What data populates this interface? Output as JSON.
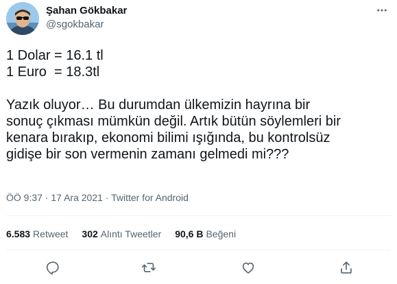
{
  "author": {
    "display_name": "Şahan Gökbakar",
    "handle": "@sgokbakar"
  },
  "tweet": {
    "lines": [
      "1 Dolar = 16.1 tl",
      "1 Euro  = 18.3tl",
      "",
      "Yazık oluyor… Bu durumdan ülkemizin hayrına bir",
      "sonuç çıkması mümkün değil. Artık bütün söylemleri bir",
      "kenara bırakıp, ekonomi bilimi ışığında, bu kontrolsüz",
      "gidişe bir son vermenin zamanı gelmedi mi???"
    ]
  },
  "meta": {
    "time": "ÖÖ 9:37",
    "separator": "·",
    "date": "17 Ara 2021",
    "source": "Twitter for Android"
  },
  "stats": {
    "retweets": {
      "count": "6.583",
      "label": "Retweet"
    },
    "quotes": {
      "count": "302",
      "label": "Alıntı Tweetler"
    },
    "likes": {
      "count": "90,6 B",
      "label": "Beğeni"
    }
  },
  "icons": {
    "more": "more-horizontal-icon",
    "reply": "reply-icon",
    "retweet": "retweet-icon",
    "like": "heart-icon",
    "share": "share-icon"
  },
  "colors": {
    "text": "#0f1419",
    "secondary": "#536471",
    "divider": "#eff3f4"
  }
}
